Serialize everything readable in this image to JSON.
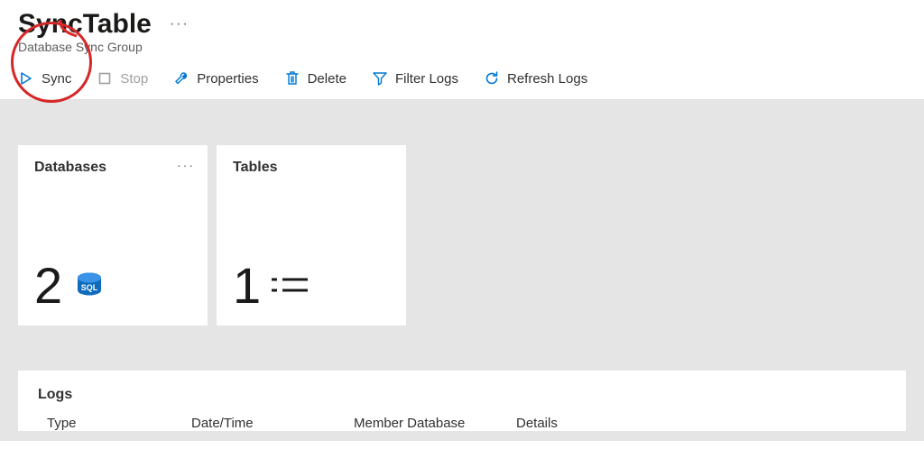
{
  "header": {
    "title": "SyncTable",
    "subtitle": "Database Sync Group",
    "more": "···"
  },
  "toolbar": {
    "sync": "Sync",
    "stop": "Stop",
    "properties": "Properties",
    "delete": "Delete",
    "filter": "Filter Logs",
    "refresh": "Refresh Logs"
  },
  "cards": {
    "databases": {
      "title": "Databases",
      "value": "2",
      "more": "···"
    },
    "tables": {
      "title": "Tables",
      "value": "1"
    }
  },
  "logs": {
    "title": "Logs",
    "columns": {
      "type": "Type",
      "datetime": "Date/Time",
      "member": "Member Database",
      "details": "Details"
    }
  }
}
